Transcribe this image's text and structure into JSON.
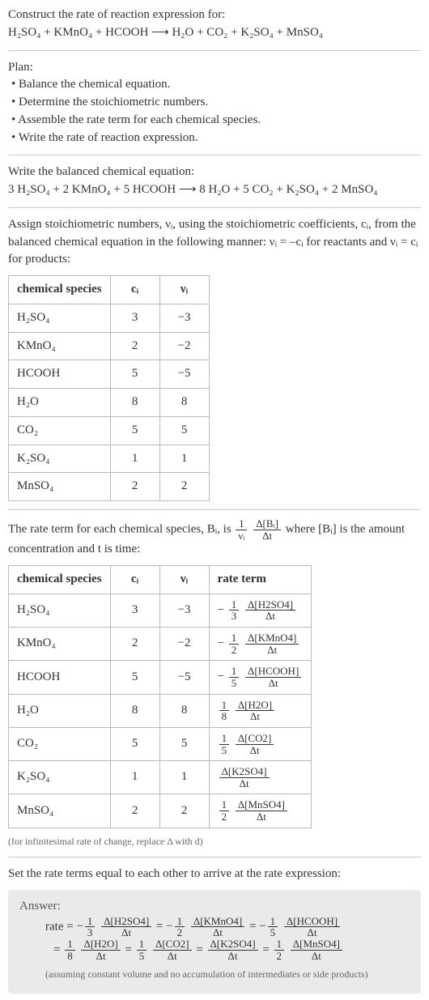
{
  "prompt_line1": "Construct the rate of reaction expression for:",
  "prompt_eq": "H₂SO₄ + KMnO₄ + HCOOH ⟶ H₂O + CO₂ + K₂SO₄ + MnSO₄",
  "plan_heading": "Plan:",
  "plan_items": [
    "Balance the chemical equation.",
    "Determine the stoichiometric numbers.",
    "Assemble the rate term for each chemical species.",
    "Write the rate of reaction expression."
  ],
  "balanced_heading": "Write the balanced chemical equation:",
  "balanced_eq": "3 H₂SO₄ + 2 KMnO₄ + 5 HCOOH ⟶ 8 H₂O + 5 CO₂ + K₂SO₄ + 2 MnSO₄",
  "assign_text_a": "Assign stoichiometric numbers, νᵢ, using the stoichiometric coefficients, cᵢ, from the balanced chemical equation in the following manner: νᵢ = –cᵢ for reactants and νᵢ = cᵢ for products:",
  "table1_headers": [
    "chemical species",
    "cᵢ",
    "νᵢ"
  ],
  "table1_rows": [
    {
      "species": "H₂SO₄",
      "c": "3",
      "v": "−3"
    },
    {
      "species": "KMnO₄",
      "c": "2",
      "v": "−2"
    },
    {
      "species": "HCOOH",
      "c": "5",
      "v": "−5"
    },
    {
      "species": "H₂O",
      "c": "8",
      "v": "8"
    },
    {
      "species": "CO₂",
      "c": "5",
      "v": "5"
    },
    {
      "species": "K₂SO₄",
      "c": "1",
      "v": "1"
    },
    {
      "species": "MnSO₄",
      "c": "2",
      "v": "2"
    }
  ],
  "rate_term_text_a": "The rate term for each chemical species, Bᵢ, is ",
  "rate_term_frac_left_num": "1",
  "rate_term_frac_left_den": "νᵢ",
  "rate_term_frac_right_num": "Δ[Bᵢ]",
  "rate_term_frac_right_den": "Δt",
  "rate_term_text_b": " where [Bᵢ] is the amount concentration and t is time:",
  "table2_headers": [
    "chemical species",
    "cᵢ",
    "νᵢ",
    "rate term"
  ],
  "table2_rows": [
    {
      "species": "H₂SO₄",
      "c": "3",
      "v": "−3",
      "sign": "−",
      "coef_num": "1",
      "coef_den": "3",
      "delta_num": "Δ[H2SO4]",
      "delta_den": "Δt"
    },
    {
      "species": "KMnO₄",
      "c": "2",
      "v": "−2",
      "sign": "−",
      "coef_num": "1",
      "coef_den": "2",
      "delta_num": "Δ[KMnO4]",
      "delta_den": "Δt"
    },
    {
      "species": "HCOOH",
      "c": "5",
      "v": "−5",
      "sign": "−",
      "coef_num": "1",
      "coef_den": "5",
      "delta_num": "Δ[HCOOH]",
      "delta_den": "Δt"
    },
    {
      "species": "H₂O",
      "c": "8",
      "v": "8",
      "sign": "",
      "coef_num": "1",
      "coef_den": "8",
      "delta_num": "Δ[H2O]",
      "delta_den": "Δt"
    },
    {
      "species": "CO₂",
      "c": "5",
      "v": "5",
      "sign": "",
      "coef_num": "1",
      "coef_den": "5",
      "delta_num": "Δ[CO2]",
      "delta_den": "Δt"
    },
    {
      "species": "K₂SO₄",
      "c": "1",
      "v": "1",
      "sign": "",
      "coef_num": "",
      "coef_den": "",
      "delta_num": "Δ[K2SO4]",
      "delta_den": "Δt"
    },
    {
      "species": "MnSO₄",
      "c": "2",
      "v": "2",
      "sign": "",
      "coef_num": "1",
      "coef_den": "2",
      "delta_num": "Δ[MnSO4]",
      "delta_den": "Δt"
    }
  ],
  "infinitesimal_note": "(for infinitesimal rate of change, replace Δ with d)",
  "set_equal_text": "Set the rate terms equal to each other to arrive at the rate expression:",
  "answer_label": "Answer:",
  "answer_rate_prefix": "rate = ",
  "answer_terms_line1": [
    {
      "sign": "−",
      "coef_num": "1",
      "coef_den": "3",
      "num": "Δ[H2SO4]",
      "den": "Δt"
    },
    {
      "sign": "= −",
      "coef_num": "1",
      "coef_den": "2",
      "num": "Δ[KMnO4]",
      "den": "Δt"
    },
    {
      "sign": "= −",
      "coef_num": "1",
      "coef_den": "5",
      "num": "Δ[HCOOH]",
      "den": "Δt"
    }
  ],
  "answer_terms_line2": [
    {
      "sign": "= ",
      "coef_num": "1",
      "coef_den": "8",
      "num": "Δ[H2O]",
      "den": "Δt"
    },
    {
      "sign": "= ",
      "coef_num": "1",
      "coef_den": "5",
      "num": "Δ[CO2]",
      "den": "Δt"
    },
    {
      "sign": "= ",
      "coef_num": "",
      "coef_den": "",
      "num": "Δ[K2SO4]",
      "den": "Δt"
    },
    {
      "sign": "= ",
      "coef_num": "1",
      "coef_den": "2",
      "num": "Δ[MnSO4]",
      "den": "Δt"
    }
  ],
  "answer_assumption": "(assuming constant volume and no accumulation of intermediates or side products)"
}
